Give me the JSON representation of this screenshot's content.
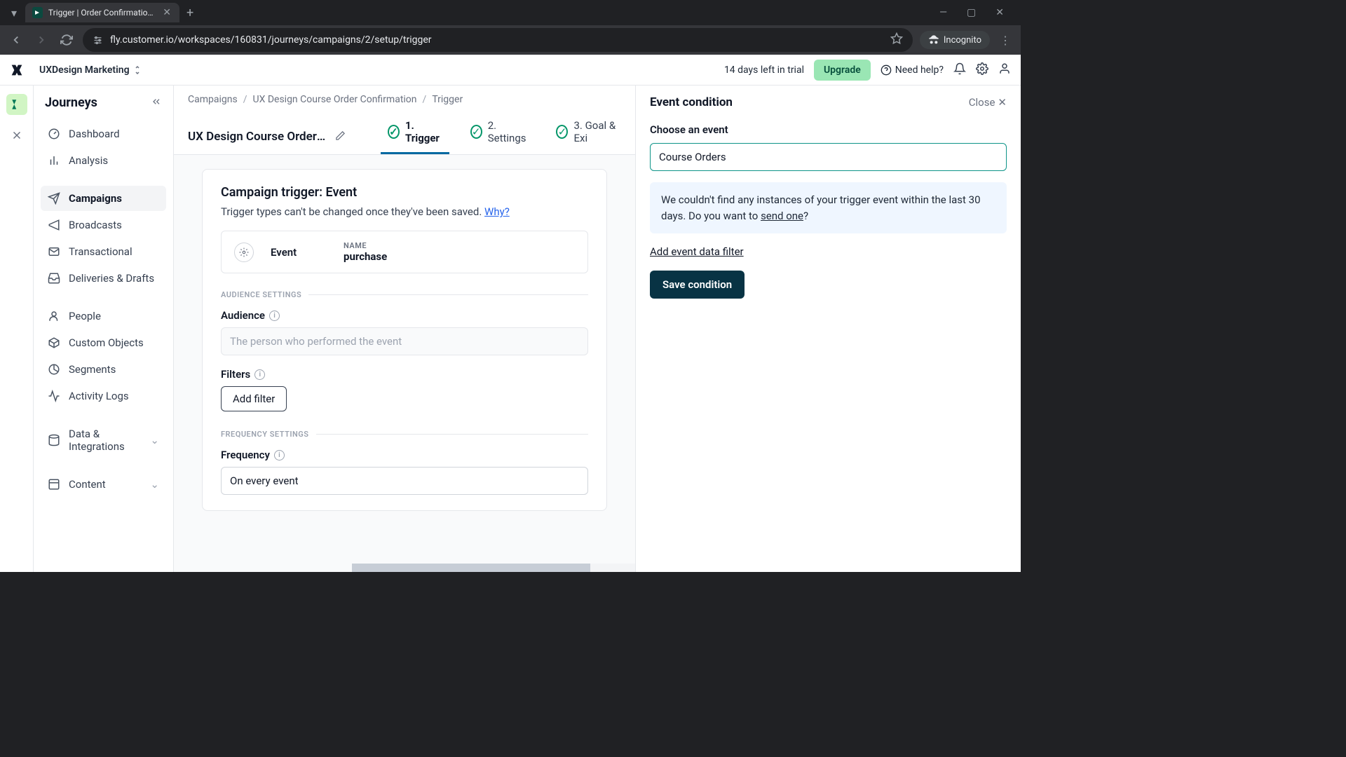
{
  "browser": {
    "tab_title": "Trigger | Order Confirmation | C",
    "url": "fly.customer.io/workspaces/160831/journeys/campaigns/2/setup/trigger",
    "incognito": "Incognito"
  },
  "topbar": {
    "workspace": "UXDesign Marketing",
    "trial": "14 days left in trial",
    "upgrade": "Upgrade",
    "help": "Need help?"
  },
  "sidebar": {
    "title": "Journeys",
    "items": [
      "Dashboard",
      "Analysis",
      "Campaigns",
      "Broadcasts",
      "Transactional",
      "Deliveries & Drafts",
      "People",
      "Custom Objects",
      "Segments",
      "Activity Logs",
      "Data & Integrations",
      "Content"
    ]
  },
  "breadcrumb": {
    "a": "Campaigns",
    "b": "UX Design Course Order Confirmation",
    "c": "Trigger"
  },
  "header": {
    "campaign_title": "UX Design Course Order Confi…",
    "step1": "1. Trigger",
    "step2": "2. Settings",
    "step3": "3. Goal & Exi"
  },
  "card": {
    "title": "Campaign trigger: Event",
    "subtitle_a": "Trigger types can't be changed once they've been saved. ",
    "subtitle_link": "Why?",
    "event_label": "Event",
    "name_label": "NAME",
    "name_value": "purchase",
    "audience_section": "AUDIENCE SETTINGS",
    "audience_label": "Audience",
    "audience_value": "The person who performed the event",
    "filters_label": "Filters",
    "add_filter": "Add filter",
    "freq_section": "FREQUENCY SETTINGS",
    "freq_label": "Frequency",
    "freq_value": "On every event"
  },
  "panel": {
    "title": "Event condition",
    "close": "Close",
    "choose_label": "Choose an event",
    "event_value": "Course Orders",
    "notice_a": "We couldn't find any instances of your trigger event within the last 30 days. Do you want to ",
    "notice_link": "send one",
    "notice_b": "?",
    "add_filter_link": "Add event data filter",
    "save": "Save condition"
  }
}
